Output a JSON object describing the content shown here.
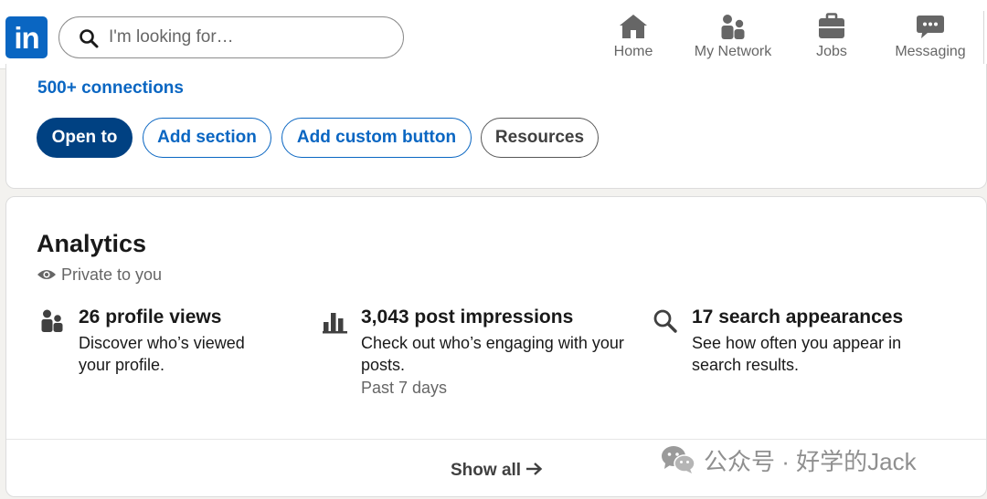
{
  "header": {
    "logo_text": "in",
    "search": {
      "placeholder": "I'm looking for…"
    },
    "nav": [
      {
        "label": "Home",
        "icon": "home-icon"
      },
      {
        "label": "My Network",
        "icon": "people-icon"
      },
      {
        "label": "Jobs",
        "icon": "briefcase-icon"
      },
      {
        "label": "Messaging",
        "icon": "chat-icon"
      }
    ]
  },
  "profile": {
    "connections": "500+ connections",
    "buttons": [
      {
        "label": "Open to",
        "style": "primary"
      },
      {
        "label": "Add section",
        "style": "outline"
      },
      {
        "label": "Add custom button",
        "style": "outline"
      },
      {
        "label": "Resources",
        "style": "gray"
      }
    ]
  },
  "analytics": {
    "title": "Analytics",
    "privacy": "Private to you",
    "metrics": [
      {
        "icon": "people-icon",
        "title": "26 profile views",
        "description": "Discover who’s viewed your profile.",
        "note": ""
      },
      {
        "icon": "bar-chart-icon",
        "title": "3,043 post impressions",
        "description": "Check out who’s engaging with your posts.",
        "note": "Past 7 days"
      },
      {
        "icon": "search-icon",
        "title": "17 search appearances",
        "description": "See how often you appear in search results.",
        "note": ""
      }
    ],
    "show_all": "Show all"
  },
  "watermark": {
    "text": "公众号 · 好学的Jack",
    "icon": "wechat-icon"
  },
  "colors": {
    "brand": "#0a66c2",
    "primary_button": "#004182",
    "page_background": "#f3f2ef",
    "muted_text": "#666666"
  }
}
